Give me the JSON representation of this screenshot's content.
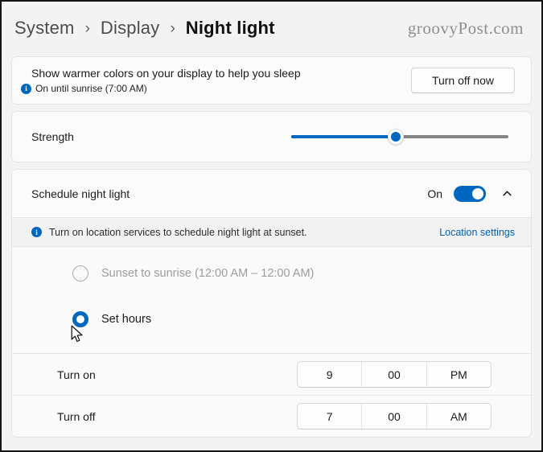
{
  "breadcrumb": {
    "items": [
      {
        "label": "System"
      },
      {
        "label": "Display"
      },
      {
        "label": "Night light"
      }
    ],
    "separator": "›"
  },
  "watermark": "groovyPost.com",
  "warm_colors": {
    "title": "Show warmer colors on your display to help you sleep",
    "status": "On until sunrise (7:00 AM)",
    "button": "Turn off now"
  },
  "strength": {
    "label": "Strength",
    "percent": 48
  },
  "schedule": {
    "title": "Schedule night light",
    "toggle_state": "On",
    "info": {
      "message": "Turn on location services to schedule night light at sunset.",
      "link": "Location settings"
    },
    "option_sunset": {
      "label": "Sunset to sunrise (12:00 AM – 12:00 AM)",
      "selected": false,
      "disabled": true
    },
    "option_hours": {
      "label": "Set hours",
      "selected": true,
      "disabled": false
    },
    "turn_on": {
      "label": "Turn on",
      "hour": "9",
      "minute": "00",
      "period": "PM"
    },
    "turn_off": {
      "label": "Turn off",
      "hour": "7",
      "minute": "00",
      "period": "AM"
    }
  },
  "icons": {
    "info": "i",
    "breadcrumb_chevron": "chevron-right",
    "expander_chevron": "chevron-up"
  },
  "colors": {
    "accent": "#0067c0",
    "link": "#005fb8",
    "page_bg": "#f3f3f3",
    "card_bg": "#fbfbfb"
  }
}
